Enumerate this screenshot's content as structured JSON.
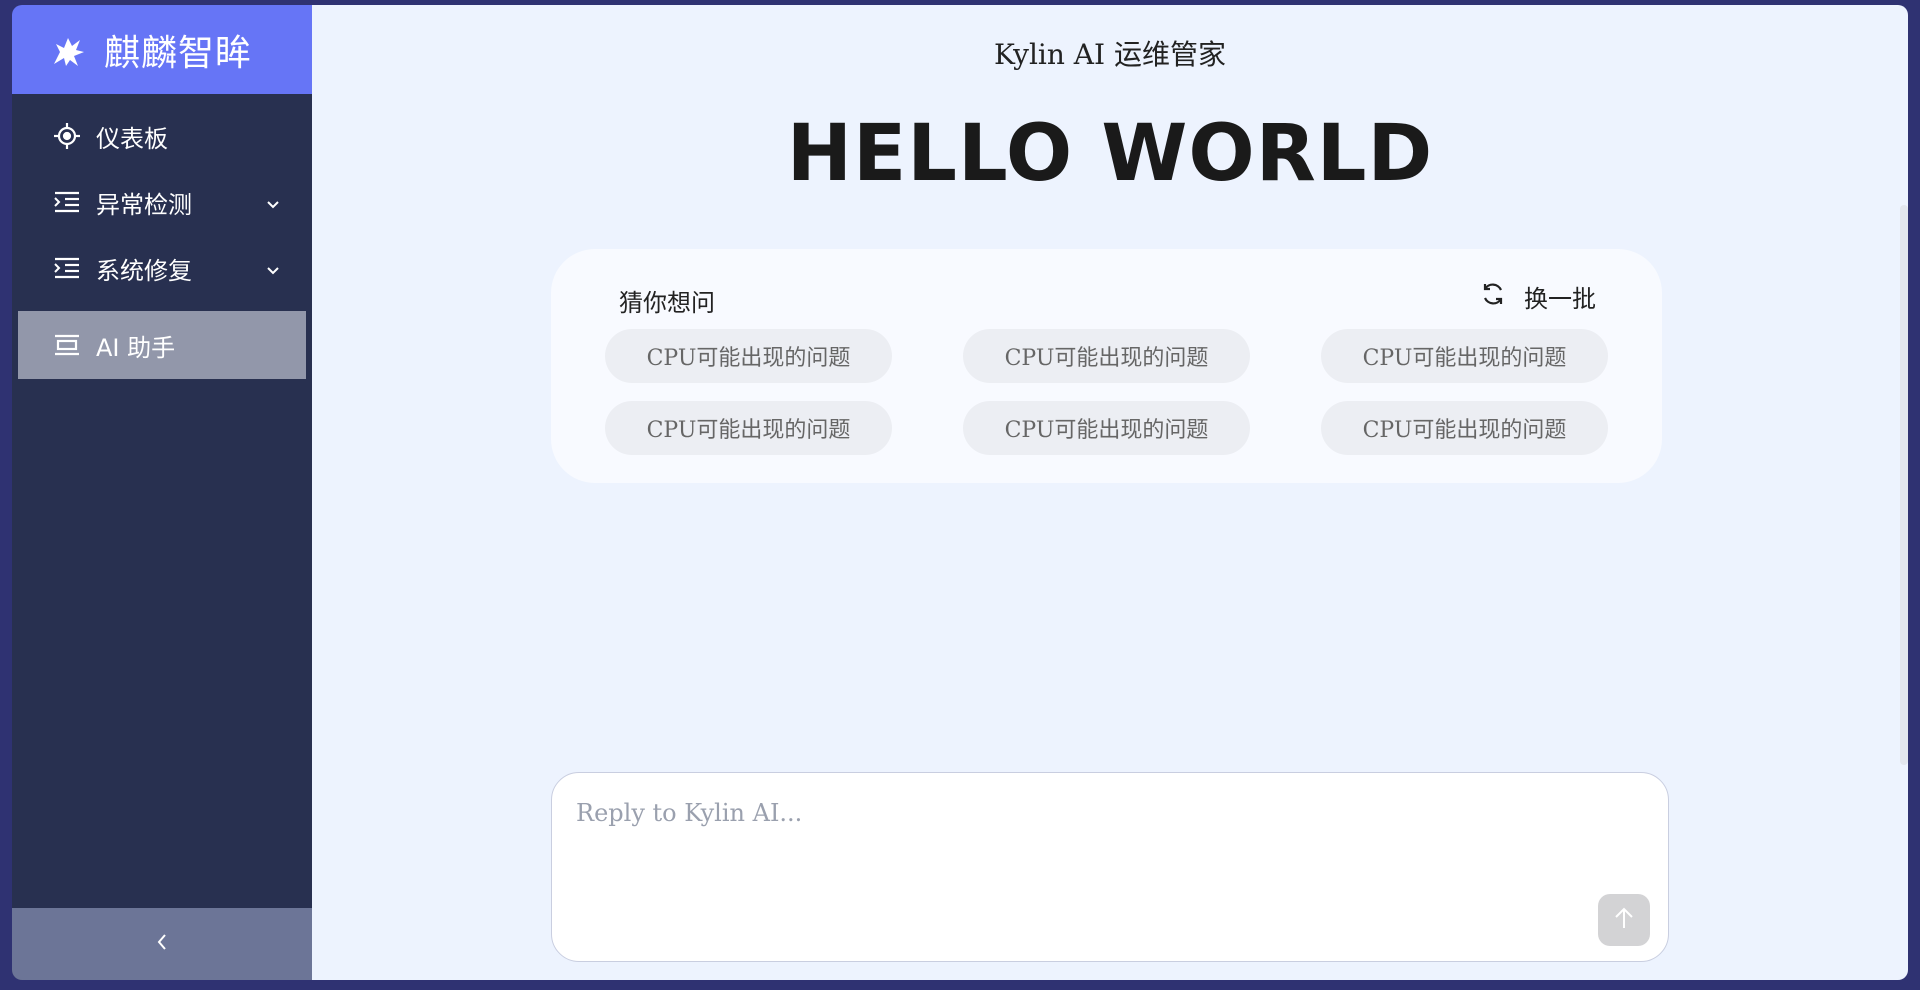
{
  "sidebar": {
    "brand_title": "麒麟智眸",
    "items": [
      {
        "label": "仪表板",
        "icon": "target-icon"
      },
      {
        "label": "异常检测",
        "icon": "indent-list-icon",
        "expandable": true
      },
      {
        "label": "系统修复",
        "icon": "indent-list-icon",
        "expandable": true
      },
      {
        "label": "AI 助手",
        "icon": "panel-icon",
        "active": true
      }
    ],
    "collapse_label": "<"
  },
  "main": {
    "header_title": "Kylin AI 运维管家",
    "hero": "HELLO WORLD",
    "suggestions": {
      "title": "猜你想问",
      "refresh_label": "换一批",
      "chips": [
        "CPU可能出现的问题",
        "CPU可能出现的问题",
        "CPU可能出现的问题",
        "CPU可能出现的问题",
        "CPU可能出现的问题",
        "CPU可能出现的问题"
      ]
    },
    "reply": {
      "placeholder": "Reply to Kylin AI...",
      "value": ""
    }
  },
  "colors": {
    "sidebar_bg": "#283050",
    "brand_bg": "#6675f6",
    "active_item_bg": "#9297aa",
    "main_bg": "#edf3fe",
    "page_border": "#2f3272"
  }
}
